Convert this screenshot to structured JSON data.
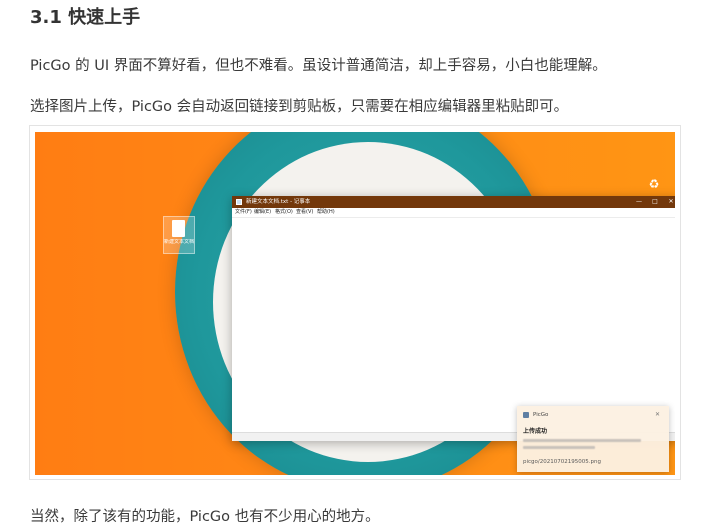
{
  "article": {
    "heading": "3.1 快速上手",
    "paragraphs": [
      "PicGo 的 UI 界面不算好看，但也不难看。虽设计普通简洁，却上手容易，小白也能理解。",
      "选择图片上传，PicGo 会自动返回链接到剪贴板，只需要在相应编辑器里粘贴即可。",
      "当然，除了该有的功能，PicGo 也有不少用心的地方。"
    ]
  },
  "screenshot": {
    "notepad": {
      "title": "新建文本文档.txt - 记事本",
      "controls": [
        "—",
        "□",
        "✕"
      ],
      "menu": [
        "文件(F)",
        "编辑(E)",
        "格式(O)",
        "查看(V)",
        "帮助(H)"
      ]
    },
    "desktop_file": {
      "caption": "新建文本文档.txt",
      "icon": "text-file-icon"
    },
    "recycle_bin": {
      "icon": "recycle-bin-icon"
    },
    "toast": {
      "app_name": "PicGo",
      "close": "✕",
      "title": "上传成功",
      "url": "picgo/20210702195005.png"
    },
    "colors": {
      "desktop_orange": "#ff8a16",
      "plate_teal": "#1f989c",
      "notepad_titlebar": "#73380b"
    }
  }
}
